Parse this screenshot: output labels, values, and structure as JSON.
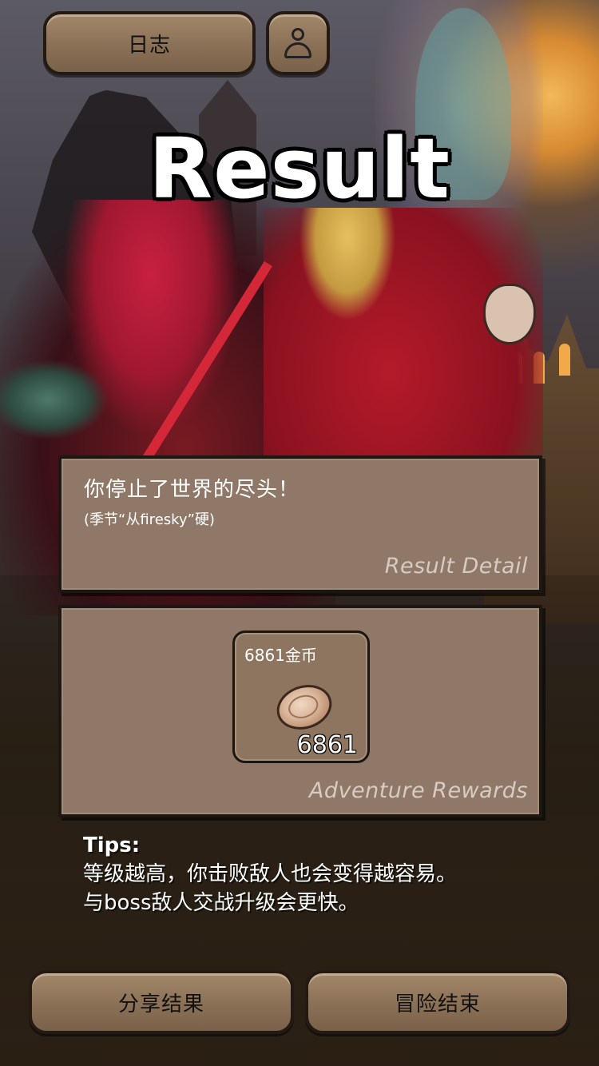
{
  "header": {
    "log_label": "日志",
    "profile_icon": "person-icon"
  },
  "title": "Result",
  "result_detail": {
    "message": "你停止了世界的尽头！",
    "sub_message": "(季节“从firesky”硬)",
    "caption": "Result Detail"
  },
  "adventure_rewards": {
    "items": [
      {
        "name": "6861金币",
        "icon": "coin-icon",
        "count": "6861"
      }
    ],
    "caption": "Adventure Rewards"
  },
  "tips": {
    "label": "Tips:",
    "line1": "等级越高，你击败敌人也会变得越容易。",
    "line2": "与boss敌人交战升级会更快。"
  },
  "footer": {
    "share_label": "分享结果",
    "end_label": "冒险结束"
  },
  "colors": {
    "button_brown": "#8a7056",
    "panel_brown": "#8f7867",
    "border_dark": "#1d1714"
  }
}
